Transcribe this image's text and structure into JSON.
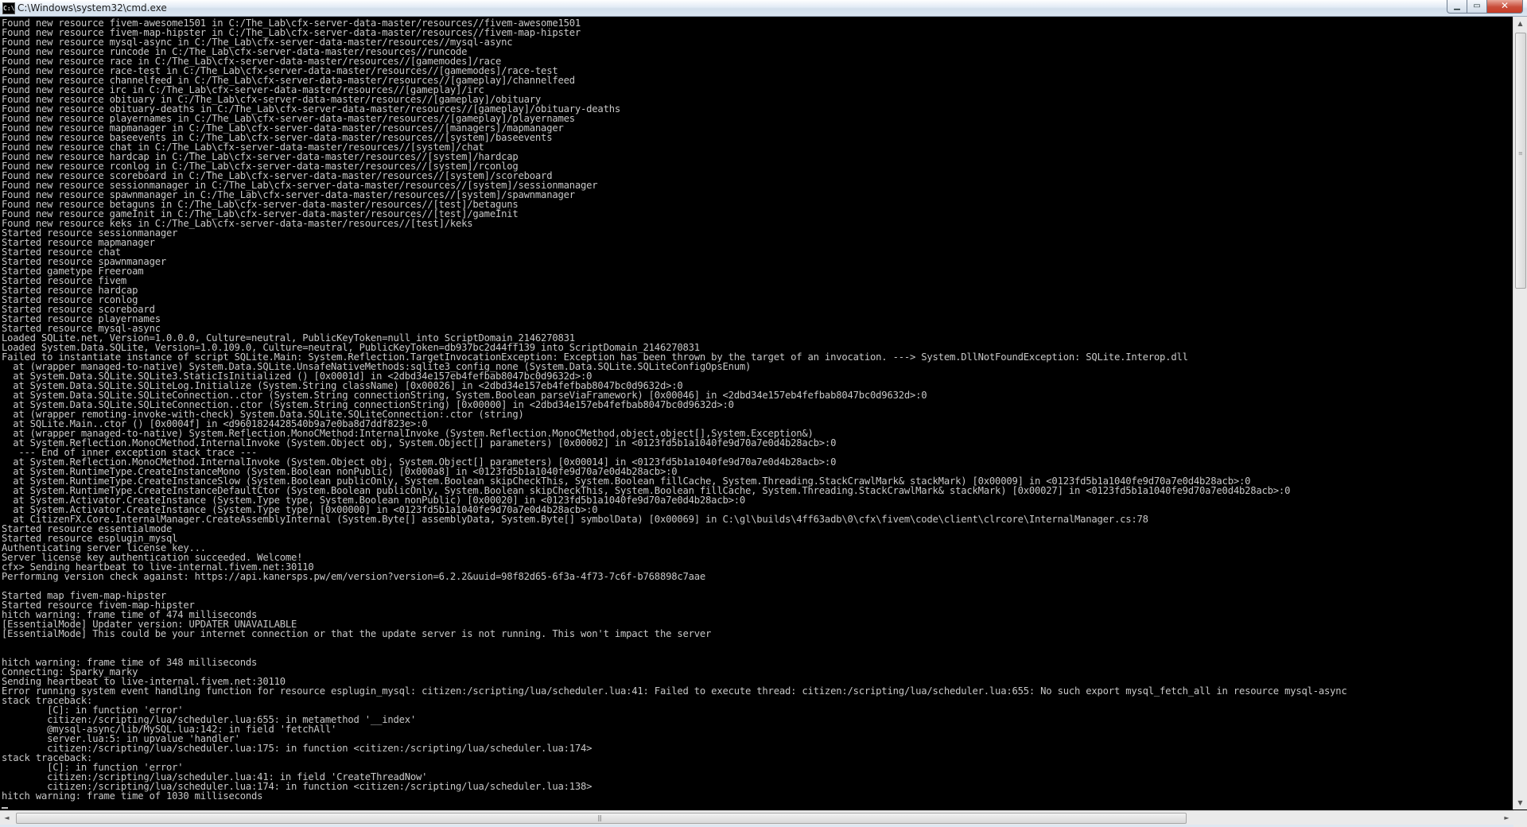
{
  "window": {
    "title": "C:\\Windows\\system32\\cmd.exe",
    "icon": "cmd-icon",
    "controls": {
      "minimize": "▁",
      "maximize": "▭",
      "close": "✕"
    }
  },
  "console": {
    "lines": [
      "Found new resource fivem-awesome1501 in C:/The_Lab\\cfx-server-data-master/resources//fivem-awesome1501",
      "Found new resource fivem-map-hipster in C:/The_Lab\\cfx-server-data-master/resources//fivem-map-hipster",
      "Found new resource mysql-async in C:/The_Lab\\cfx-server-data-master/resources//mysql-async",
      "Found new resource runcode in C:/The_Lab\\cfx-server-data-master/resources//runcode",
      "Found new resource race in C:/The_Lab\\cfx-server-data-master/resources//[gamemodes]/race",
      "Found new resource race-test in C:/The_Lab\\cfx-server-data-master/resources//[gamemodes]/race-test",
      "Found new resource channelfeed in C:/The_Lab\\cfx-server-data-master/resources//[gameplay]/channelfeed",
      "Found new resource irc in C:/The_Lab\\cfx-server-data-master/resources//[gameplay]/irc",
      "Found new resource obituary in C:/The_Lab\\cfx-server-data-master/resources//[gameplay]/obituary",
      "Found new resource obituary-deaths in C:/The_Lab\\cfx-server-data-master/resources//[gameplay]/obituary-deaths",
      "Found new resource playernames in C:/The_Lab\\cfx-server-data-master/resources//[gameplay]/playernames",
      "Found new resource mapmanager in C:/The_Lab\\cfx-server-data-master/resources//[managers]/mapmanager",
      "Found new resource baseevents in C:/The_Lab\\cfx-server-data-master/resources//[system]/baseevents",
      "Found new resource chat in C:/The_Lab\\cfx-server-data-master/resources//[system]/chat",
      "Found new resource hardcap in C:/The_Lab\\cfx-server-data-master/resources//[system]/hardcap",
      "Found new resource rconlog in C:/The_Lab\\cfx-server-data-master/resources//[system]/rconlog",
      "Found new resource scoreboard in C:/The_Lab\\cfx-server-data-master/resources//[system]/scoreboard",
      "Found new resource sessionmanager in C:/The_Lab\\cfx-server-data-master/resources//[system]/sessionmanager",
      "Found new resource spawnmanager in C:/The_Lab\\cfx-server-data-master/resources//[system]/spawnmanager",
      "Found new resource betaguns in C:/The_Lab\\cfx-server-data-master/resources//[test]/betaguns",
      "Found new resource gameInit in C:/The_Lab\\cfx-server-data-master/resources//[test]/gameInit",
      "Found new resource keks in C:/The_Lab\\cfx-server-data-master/resources//[test]/keks",
      "Started resource sessionmanager",
      "Started resource mapmanager",
      "Started resource chat",
      "Started resource spawnmanager",
      "Started gametype Freeroam",
      "Started resource fivem",
      "Started resource hardcap",
      "Started resource rconlog",
      "Started resource scoreboard",
      "Started resource playernames",
      "Started resource mysql-async",
      "Loaded SQLite.net, Version=1.0.0.0, Culture=neutral, PublicKeyToken=null into ScriptDomain_2146270831",
      "Loaded System.Data.SQLite, Version=1.0.109.0, Culture=neutral, PublicKeyToken=db937bc2d44ff139 into ScriptDomain_2146270831",
      "Failed to instantiate instance of script SQLite.Main: System.Reflection.TargetInvocationException: Exception has been thrown by the target of an invocation. ---> System.DllNotFoundException: SQLite.Interop.dll",
      "  at (wrapper managed-to-native) System.Data.SQLite.UnsafeNativeMethods:sqlite3_config_none (System.Data.SQLite.SQLiteConfigOpsEnum)",
      "  at System.Data.SQLite.SQLite3.StaticIsInitialized () [0x0001d] in <2dbd34e157eb4fefbab8047bc0d9632d>:0",
      "  at System.Data.SQLite.SQLiteLog.Initialize (System.String className) [0x00026] in <2dbd34e157eb4fefbab8047bc0d9632d>:0",
      "  at System.Data.SQLite.SQLiteConnection..ctor (System.String connectionString, System.Boolean parseViaFramework) [0x00046] in <2dbd34e157eb4fefbab8047bc0d9632d>:0",
      "  at System.Data.SQLite.SQLiteConnection..ctor (System.String connectionString) [0x00000] in <2dbd34e157eb4fefbab8047bc0d9632d>:0",
      "  at (wrapper remoting-invoke-with-check) System.Data.SQLite.SQLiteConnection:.ctor (string)",
      "  at SQLite.Main..ctor () [0x0004f] in <d9601824428540b9a7e0ba8d7ddf823e>:0",
      "  at (wrapper managed-to-native) System.Reflection.MonoCMethod:InternalInvoke (System.Reflection.MonoCMethod,object,object[],System.Exception&)",
      "  at System.Reflection.MonoCMethod.InternalInvoke (System.Object obj, System.Object[] parameters) [0x00002] in <0123fd5b1a1040fe9d70a7e0d4b28acb>:0",
      "   --- End of inner exception stack trace ---",
      "  at System.Reflection.MonoCMethod.InternalInvoke (System.Object obj, System.Object[] parameters) [0x00014] in <0123fd5b1a1040fe9d70a7e0d4b28acb>:0",
      "  at System.RuntimeType.CreateInstanceMono (System.Boolean nonPublic) [0x000a8] in <0123fd5b1a1040fe9d70a7e0d4b28acb>:0",
      "  at System.RuntimeType.CreateInstanceSlow (System.Boolean publicOnly, System.Boolean skipCheckThis, System.Boolean fillCache, System.Threading.StackCrawlMark& stackMark) [0x00009] in <0123fd5b1a1040fe9d70a7e0d4b28acb>:0",
      "  at System.RuntimeType.CreateInstanceDefaultCtor (System.Boolean publicOnly, System.Boolean skipCheckThis, System.Boolean fillCache, System.Threading.StackCrawlMark& stackMark) [0x00027] in <0123fd5b1a1040fe9d70a7e0d4b28acb>:0",
      "  at System.Activator.CreateInstance (System.Type type, System.Boolean nonPublic) [0x00020] in <0123fd5b1a1040fe9d70a7e0d4b28acb>:0",
      "  at System.Activator.CreateInstance (System.Type type) [0x00000] in <0123fd5b1a1040fe9d70a7e0d4b28acb>:0",
      "  at CitizenFX.Core.InternalManager.CreateAssemblyInternal (System.Byte[] assemblyData, System.Byte[] symbolData) [0x00069] in C:\\gl\\builds\\4ff63adb\\0\\cfx\\fivem\\code\\client\\clrcore\\InternalManager.cs:78",
      "Started resource essentialmode",
      "Started resource esplugin_mysql",
      "Authenticating server license key...",
      "Server license key authentication succeeded. Welcome!",
      "cfx> Sending heartbeat to live-internal.fivem.net:30110",
      "Performing version check against: https://api.kanersps.pw/em/version?version=6.2.2&uuid=98f82d65-6f3a-4f73-7c6f-b768898c7aae",
      "",
      "Started map fivem-map-hipster",
      "Started resource fivem-map-hipster",
      "hitch warning: frame time of 474 milliseconds",
      "[EssentialMode] Updater version: UPDATER UNAVAILABLE",
      "[EssentialMode] This could be your internet connection or that the update server is not running. This won't impact the server",
      "",
      "",
      "hitch warning: frame time of 348 milliseconds",
      "Connecting: Sparky_marky",
      "Sending heartbeat to live-internal.fivem.net:30110",
      "Error running system event handling function for resource esplugin_mysql: citizen:/scripting/lua/scheduler.lua:41: Failed to execute thread: citizen:/scripting/lua/scheduler.lua:655: No such export mysql_fetch_all in resource mysql-async",
      "stack traceback:",
      "        [C]: in function 'error'",
      "        citizen:/scripting/lua/scheduler.lua:655: in metamethod '__index'",
      "        @mysql-async/lib/MySQL.lua:142: in field 'fetchAll'",
      "        server.lua:5: in upvalue 'handler'",
      "        citizen:/scripting/lua/scheduler.lua:175: in function <citizen:/scripting/lua/scheduler.lua:174>",
      "stack traceback:",
      "        [C]: in function 'error'",
      "        citizen:/scripting/lua/scheduler.lua:41: in field 'CreateThreadNow'",
      "        citizen:/scripting/lua/scheduler.lua:174: in function <citizen:/scripting/lua/scheduler.lua:138>",
      "hitch warning: frame time of 1030 milliseconds"
    ]
  },
  "scrollbars": {
    "vertical": {
      "up": "▲",
      "down": "▼",
      "grip": "≡"
    },
    "horizontal": {
      "left": "◄",
      "right": "►",
      "grip": "|||"
    }
  },
  "colors": {
    "console_bg": "#000000",
    "console_text": "#c0c0c0"
  }
}
